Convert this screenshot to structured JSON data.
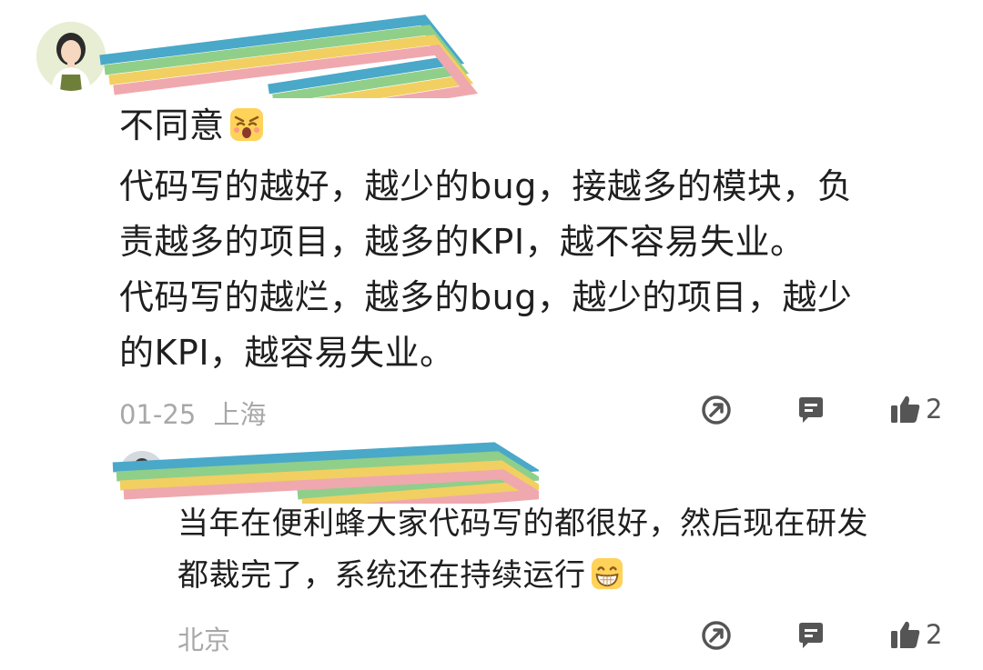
{
  "comments": [
    {
      "lines": [
        "不同意",
        "代码写的越好，越少的bug，接越多的模块，负",
        "责越多的项目，越多的KPI，越不容易失业。",
        "代码写的越烂，越多的bug，越少的项目，越少",
        "的KPI，越容易失业。"
      ],
      "date": "01-25",
      "location": "上海",
      "like_count": "2",
      "emoji_icon": "weary-face-icon"
    },
    {
      "lines": [
        "当年在便利蜂大家代码写的都很好，然后现在研发",
        "都裁完了，系统还在持续运行"
      ],
      "location": "北京",
      "like_count": "2",
      "emoji_icon": "grinning-face-icon"
    }
  ],
  "colors": {
    "meta_gray": "#a8a8a8",
    "icon_gray": "#555555",
    "scribble": [
      "#4aa8c9",
      "#8fcf8a",
      "#f2cf61",
      "#efa8ae"
    ]
  }
}
